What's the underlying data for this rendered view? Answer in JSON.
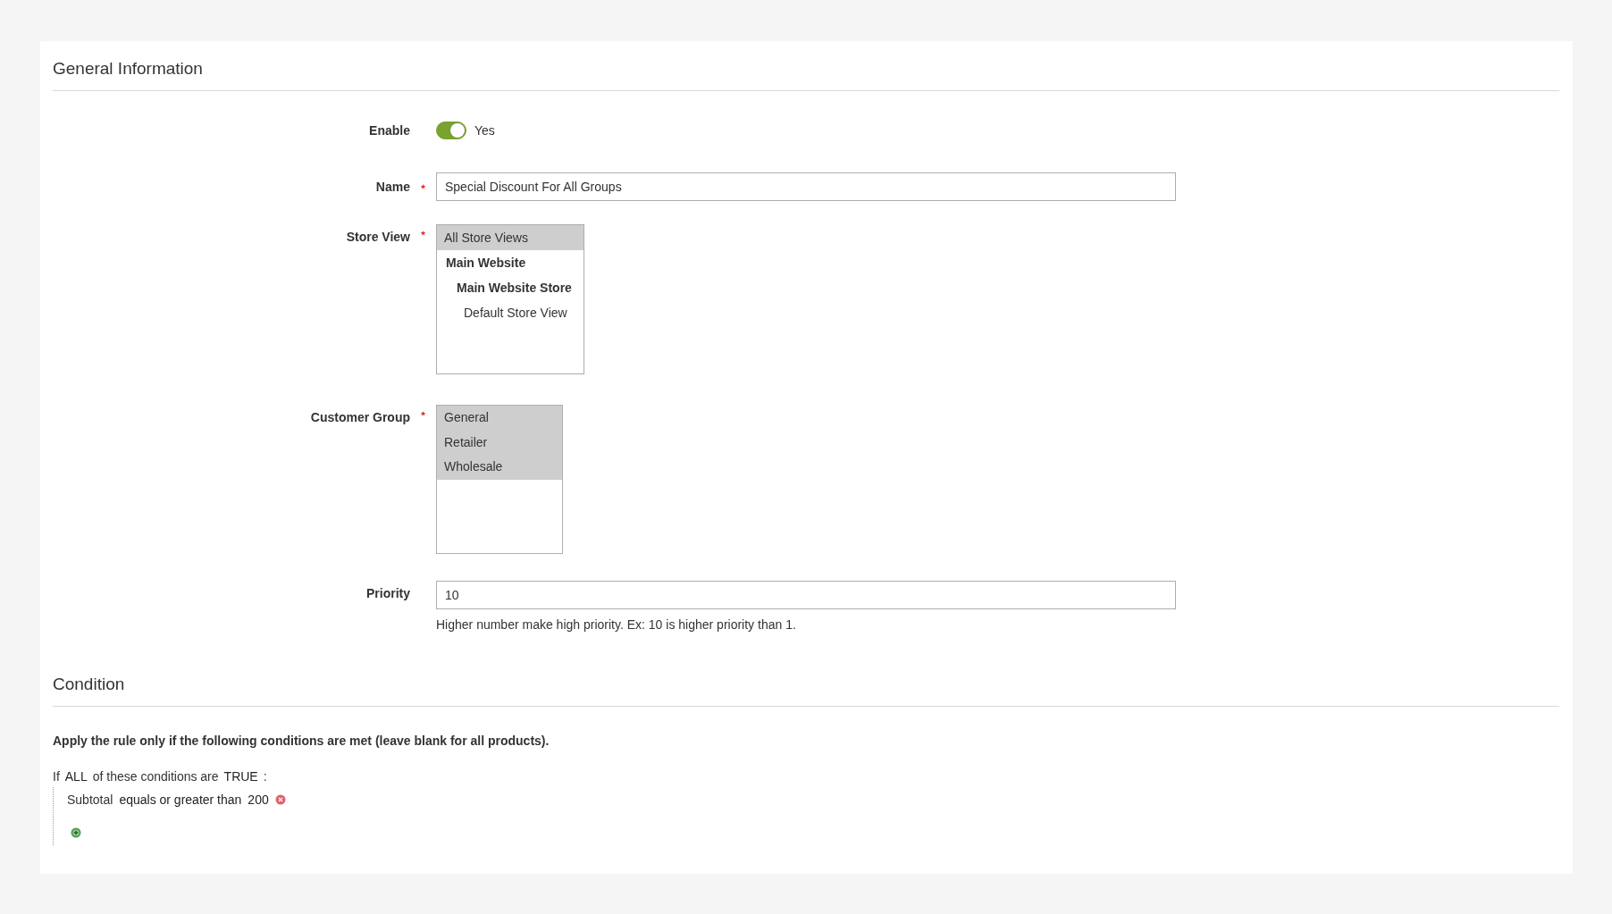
{
  "general": {
    "title": "General Information",
    "enable": {
      "label": "Enable",
      "on": true,
      "value_label": "Yes"
    },
    "name": {
      "label": "Name",
      "required": true,
      "value": "Special Discount For All Groups"
    },
    "store_view": {
      "label": "Store View",
      "required": true,
      "options": [
        {
          "label": "All Store Views",
          "selected": true
        },
        {
          "label": "Main Website",
          "selected": false,
          "children": [
            {
              "label": "Main Website Store",
              "selected": false,
              "children": [
                {
                  "label": "Default Store View",
                  "selected": false
                }
              ]
            }
          ]
        }
      ]
    },
    "customer_group": {
      "label": "Customer Group",
      "required": true,
      "options": [
        {
          "label": "General",
          "selected": true
        },
        {
          "label": "Retailer",
          "selected": true
        },
        {
          "label": "Wholesale",
          "selected": true
        }
      ]
    },
    "priority": {
      "label": "Priority",
      "required": false,
      "value": "10",
      "note": "Higher number make high priority. Ex: 10 is higher priority than 1."
    }
  },
  "condition": {
    "title": "Condition",
    "intro": "Apply the rule only if the following conditions are met (leave blank for all products).",
    "prefix": "If",
    "aggregator": "ALL",
    "middle": "of these conditions are",
    "value": "TRUE",
    "suffix": ":",
    "rules": [
      {
        "attribute": "Subtotal",
        "operator": "equals or greater than",
        "value": "200"
      }
    ]
  }
}
